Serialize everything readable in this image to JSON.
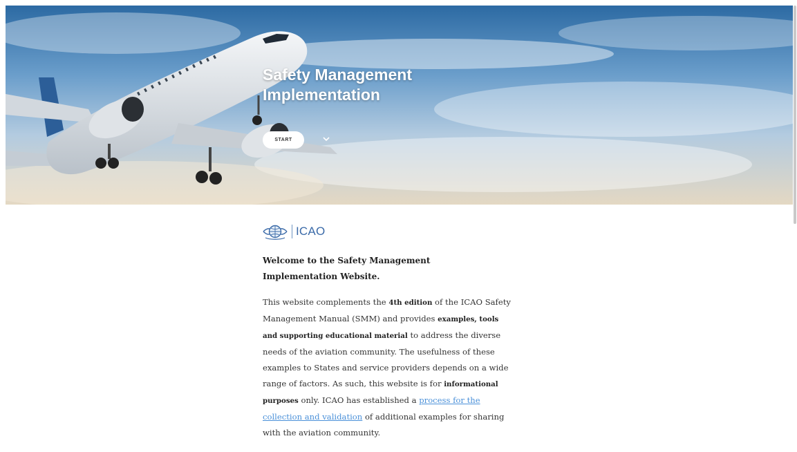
{
  "hero": {
    "title": "Safety Management Implementation",
    "start_label": "START",
    "scroll_icon": "chevron-down-icon"
  },
  "logo": {
    "emblem_icon": "icao-emblem-icon",
    "text": "ICAO"
  },
  "intro": {
    "welcome": "Welcome to the Safety Management Implementation Website.",
    "p_1": "This website complements the ",
    "b_1": "4th edition",
    "p_2": " of the ICAO Safety Management Manual (SMM) and provides ",
    "b_2": "examples, tools and supporting educational material",
    "p_3": " to address the diverse needs of the aviation community. The usefulness of these examples to States and service providers depends on a wide range of factors. As such, this website is for ",
    "b_3": "informational purposes",
    "p_4": " only. ICAO has established a ",
    "link": "process for the collection and validation",
    "p_5": " of additional examples for sharing with the aviation community."
  },
  "colors": {
    "link": "#4a90d9",
    "icao_blue": "#3a6aa8"
  }
}
